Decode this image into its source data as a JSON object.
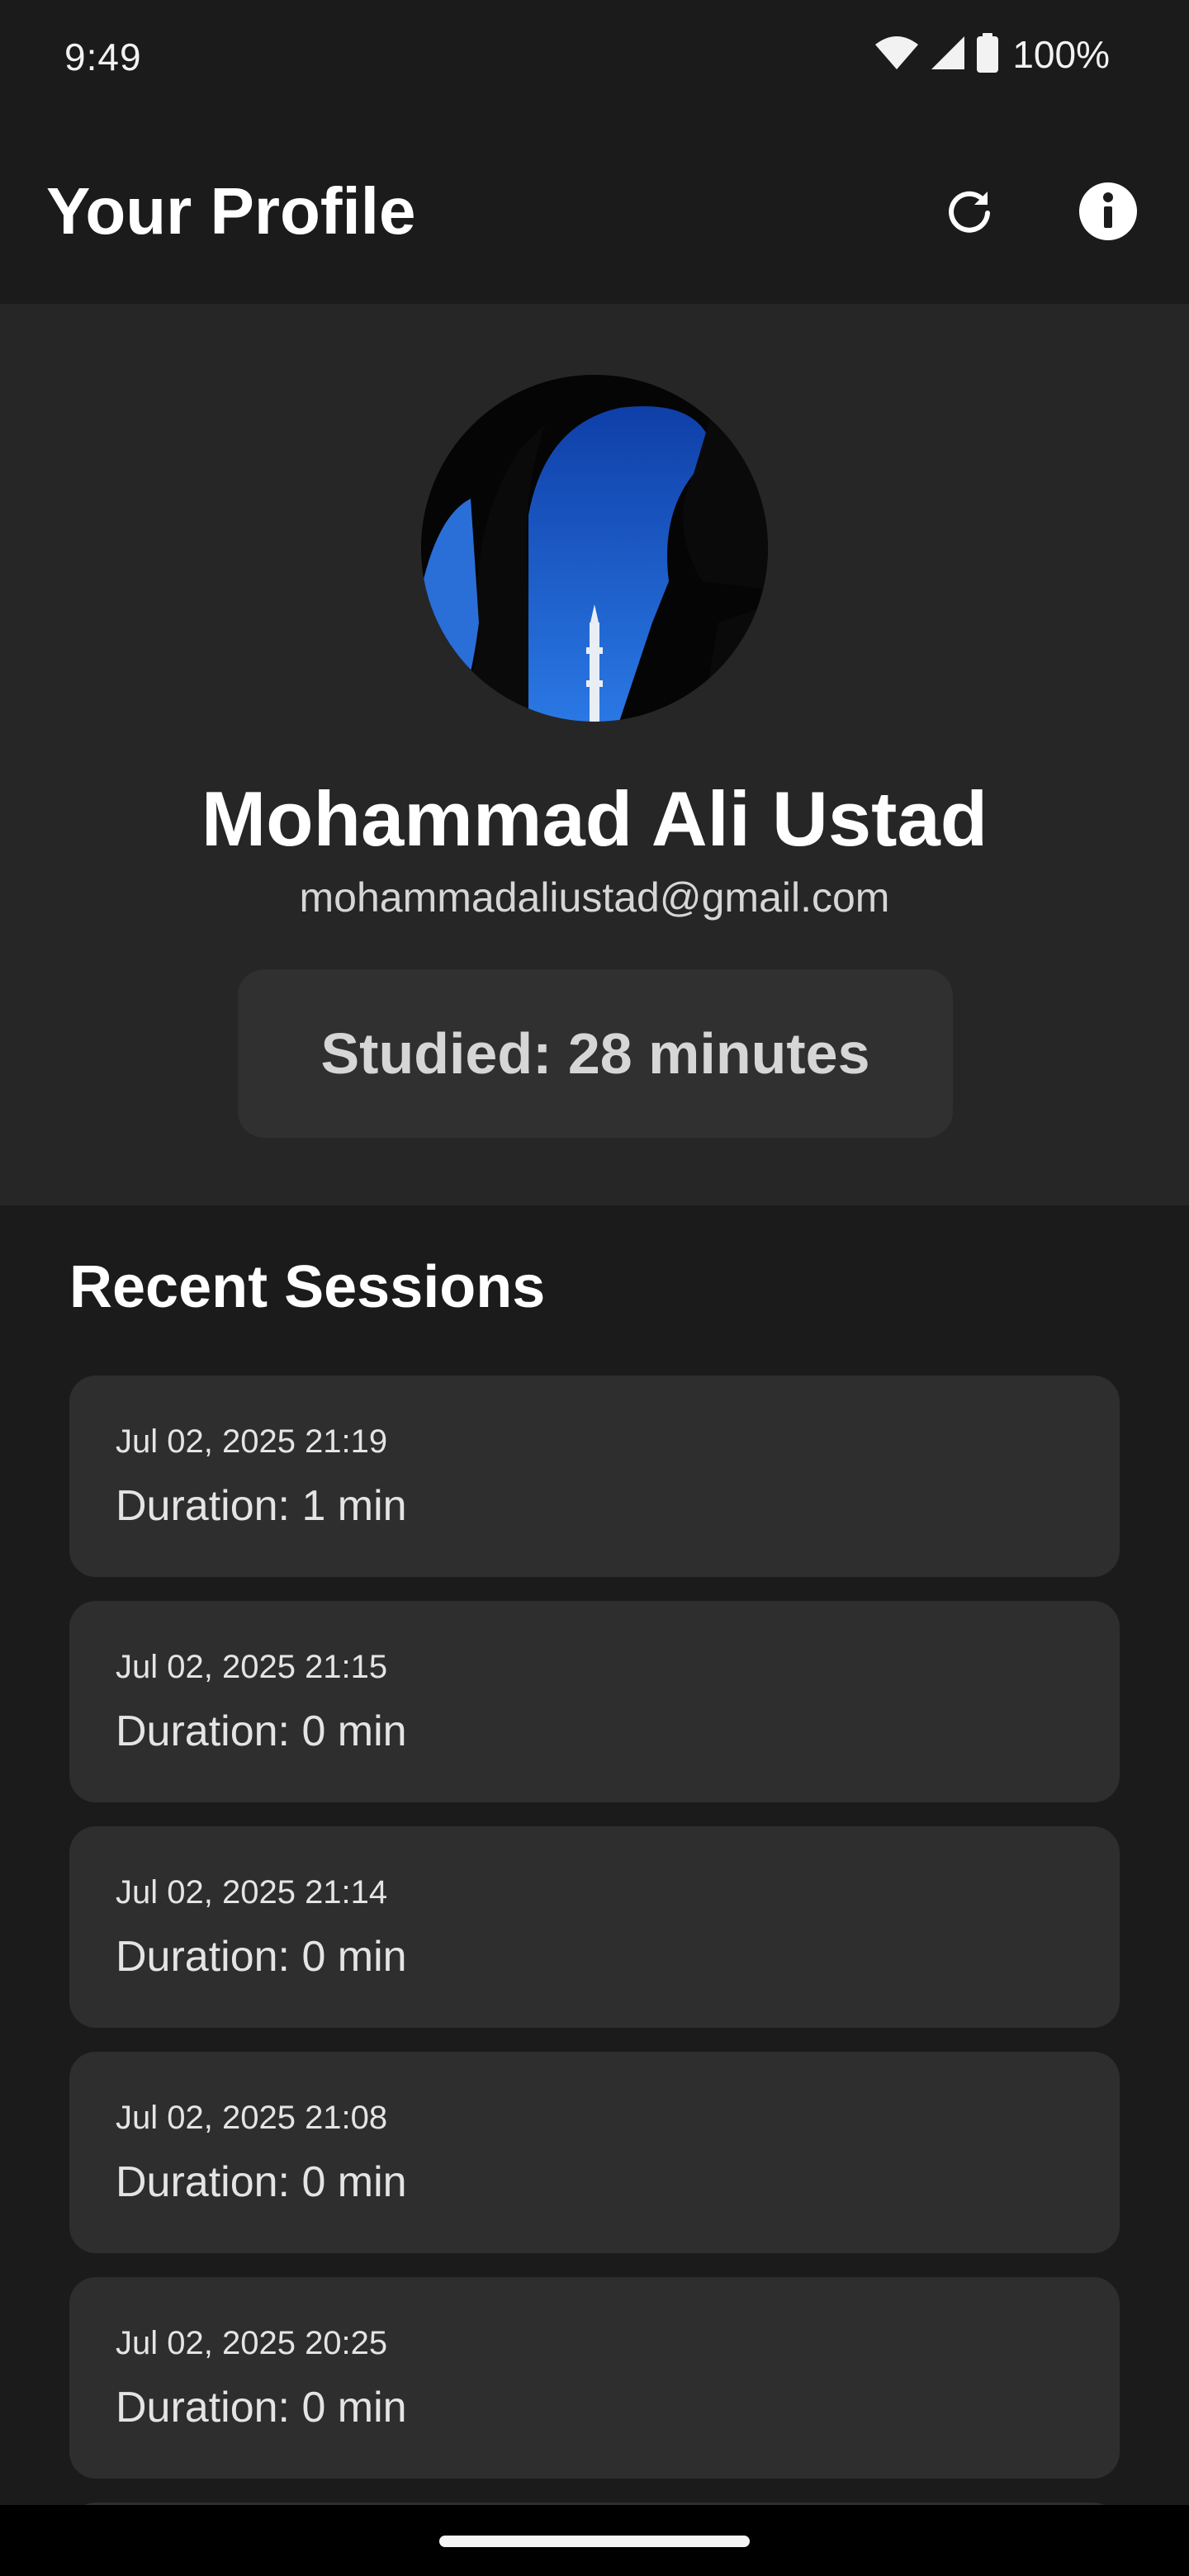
{
  "status_bar": {
    "time": "9:49",
    "battery_percent": "100%",
    "icons": [
      "wifi-icon",
      "signal-icon",
      "battery-icon"
    ]
  },
  "app_bar": {
    "title": "Your Profile",
    "actions": [
      "refresh-icon",
      "info-icon"
    ]
  },
  "profile": {
    "name": "Mohammad Ali Ustad",
    "email": "mohammadaliustad@gmail.com",
    "studied": "Studied: 28 minutes"
  },
  "sessions": {
    "title": "Recent Sessions",
    "items": [
      {
        "date": "Jul 02, 2025 21:19",
        "duration": "Duration: 1 min"
      },
      {
        "date": "Jul 02, 2025 21:15",
        "duration": "Duration: 0 min"
      },
      {
        "date": "Jul 02, 2025 21:14",
        "duration": "Duration: 0 min"
      },
      {
        "date": "Jul 02, 2025 21:08",
        "duration": "Duration: 0 min"
      },
      {
        "date": "Jul 02, 2025 20:25",
        "duration": "Duration: 0 min"
      }
    ]
  },
  "colors": {
    "background": "#1b1b1b",
    "profile_panel": "#262626",
    "card": "#2e2e2e",
    "sky_blue": "#1f5fd0"
  }
}
